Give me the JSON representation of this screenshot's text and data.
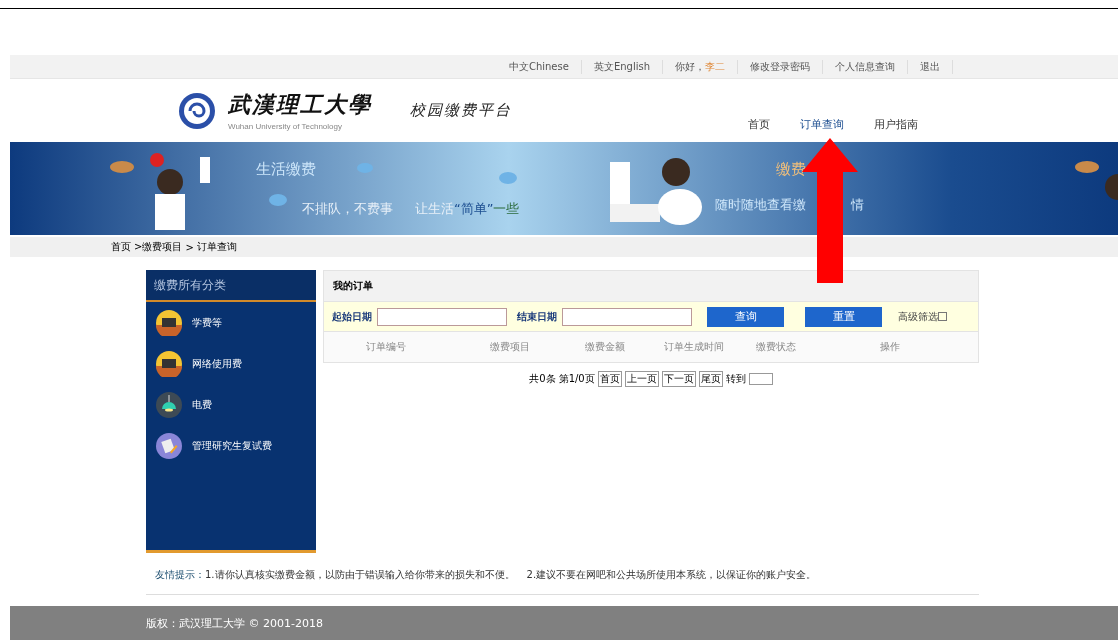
{
  "top_links": [
    {
      "text": "中文Chinese"
    },
    {
      "text": "英文English"
    },
    {
      "text": "你好，",
      "user": "李二"
    },
    {
      "text": "修改登录密码"
    },
    {
      "text": "个人信息查询"
    },
    {
      "text": "退出"
    }
  ],
  "logo": {
    "name": "武漢理工大學",
    "english": "Wuhan University of Technology"
  },
  "platform_title": "校园缴费平台",
  "nav": [
    {
      "label": "首页",
      "selected": false
    },
    {
      "label": "订单查询",
      "selected": true
    },
    {
      "label": "用户指南",
      "selected": false
    }
  ],
  "banner": {
    "title_left": "生活缴费",
    "slogan_1": "不排队，不费事",
    "slogan_2": "让生活",
    "slogan_highlight": "“简单”",
    "slogan_3": "一些",
    "title_right": "缴费",
    "subtitle_right": "随时随地查看缴",
    "subtitle_right_end": "情"
  },
  "breadcrumb": [
    "首页",
    ">缴费项目",
    ">",
    "订单查询"
  ],
  "sidebar": {
    "title": "缴费所有分类",
    "items": [
      {
        "label": "学费等",
        "kind": "monitor"
      },
      {
        "label": "网络使用费",
        "kind": "monitor"
      },
      {
        "label": "电费",
        "kind": "lamp"
      },
      {
        "label": "管理研究生复试费",
        "kind": "document"
      }
    ]
  },
  "orders": {
    "title": "我的订单",
    "start_label": "起始日期",
    "end_label": "结束日期",
    "buttons": [
      "查询",
      "重置"
    ],
    "advanced": "高级筛选",
    "advanced_checked": false,
    "columns": [
      "订单编号",
      "缴费项目",
      "缴费金额",
      "订单生成时间",
      "缴费状态",
      "操作"
    ],
    "pager": {
      "summary": "共0条",
      "page": "第1/0页",
      "buttons": [
        "首页",
        "上一页",
        "下一页",
        "尾页"
      ],
      "goto": "转到"
    }
  },
  "tips": {
    "label": "友情提示：",
    "items": [
      "1.请你认真核实缴费金额，以防由于错误输入给你带来的损失和不便。",
      "2.建议不要在网吧和公共场所使用本系统，以保证你的账户安全。"
    ]
  },
  "footer": "版权：武汉理工大学 © 2001-2018"
}
